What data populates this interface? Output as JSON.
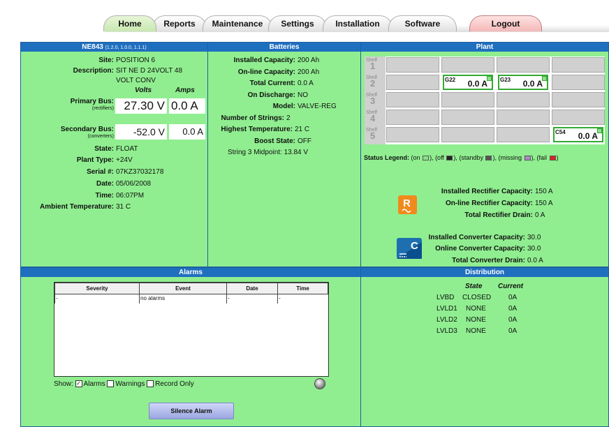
{
  "tabs": {
    "home": "Home",
    "reports": "Reports",
    "maintenance": "Maintenance",
    "settings": "Settings",
    "installation": "Installation",
    "software": "Software",
    "logout": "Logout"
  },
  "system": {
    "title": "NE843",
    "version": "(1.2.0, 1.0.0, 1.1.1)",
    "site_label": "Site:",
    "site": "POSITION 6",
    "desc_label": "Description:",
    "desc_line1": "SIT NE D 24VOLT 48",
    "desc_line2": "VOLT CONV",
    "volts_head": "Volts",
    "amps_head": "Amps",
    "primary_label": "Primary Bus:",
    "primary_sub": "(rectifiers)",
    "primary_volts": "27.30 V",
    "primary_amps": "0.0 A",
    "secondary_label": "Secondary Bus:",
    "secondary_sub": "(converters)",
    "secondary_volts": "-52.0 V",
    "secondary_amps": "0.0 A",
    "state_label": "State:",
    "state": "FLOAT",
    "plant_type_label": "Plant Type:",
    "plant_type": "+24V",
    "serial_label": "Serial #:",
    "serial": "07KZ37032178",
    "date_label": "Date:",
    "date": "05/06/2008",
    "time_label": "Time:",
    "time": "06:07PM",
    "ambient_label": "Ambient Temperature:",
    "ambient": "31 C"
  },
  "batteries": {
    "title": "Batteries",
    "installed_cap_label": "Installed Capacity:",
    "installed_cap": "200 Ah",
    "online_cap_label": "On-line Capacity:",
    "online_cap": "200 Ah",
    "total_current_label": "Total Current:",
    "total_current": "0.0 A",
    "on_discharge_label": "On Discharge:",
    "on_discharge": "NO",
    "model_label": "Model:",
    "model": "VALVE-REG",
    "strings_label": "Number of Strings:",
    "strings": "2",
    "highest_temp_label": "Highest Temperature:",
    "highest_temp": "21 C",
    "boost_label": "Boost State:",
    "boost": "OFF",
    "midpoint": "String 3 Midpoint: 13.84 V"
  },
  "plant": {
    "title": "Plant",
    "shelf_word": "Shelf",
    "shelves": [
      "1",
      "2",
      "3",
      "4",
      "5"
    ],
    "units": [
      {
        "id": "G22",
        "value": "0.0 A"
      },
      {
        "id": "G23",
        "value": "0.0 A"
      },
      {
        "id": "C54",
        "value": "0.0 A"
      }
    ],
    "legend_label": "Status Legend:",
    "legend_on": "(on",
    "legend_off": "(off",
    "legend_standby": "(standby",
    "legend_missing": "(missing",
    "legend_fail": "(fail",
    "colors": {
      "on": "#8fdf8f",
      "off": "#222222",
      "standby": "#555555",
      "missing": "#b088c8",
      "fail": "#dd2222"
    },
    "rect_installed_label": "Installed Rectifier Capacity:",
    "rect_installed": "150 A",
    "rect_online_label": "On-line Rectifier Capacity:",
    "rect_online": "150 A",
    "rect_drain_label": "Total Rectifier Drain:",
    "rect_drain": "0 A",
    "conv_installed_label": "Installed Converter Capacity:",
    "conv_installed": "30.0",
    "conv_online_label": "Online Converter Capacity:",
    "conv_online": "30.0",
    "conv_drain_label": "Total Converter Drain:",
    "conv_drain": "0.0 A",
    "rect_icon": "rectifier-icon",
    "conv_icon": "converter-icon"
  },
  "alarms": {
    "title": "Alarms",
    "columns": [
      "Severity",
      "Event",
      "Date",
      "Time"
    ],
    "rows": [
      [
        "-",
        "no alarms",
        "-",
        "-"
      ]
    ],
    "show_label": "Show:",
    "opt_alarms": "Alarms",
    "opt_warnings": "Warnings",
    "opt_record": "Record Only",
    "silence": "Silence Alarm"
  },
  "distribution": {
    "title": "Distribution",
    "state_head": "State",
    "current_head": "Current",
    "rows": [
      {
        "name": "LVBD",
        "state": "CLOSED",
        "current": "0A"
      },
      {
        "name": "LVLD1",
        "state": "NONE",
        "current": "0A"
      },
      {
        "name": "LVLD2",
        "state": "NONE",
        "current": "0A"
      },
      {
        "name": "LVLD3",
        "state": "NONE",
        "current": "0A"
      }
    ]
  }
}
